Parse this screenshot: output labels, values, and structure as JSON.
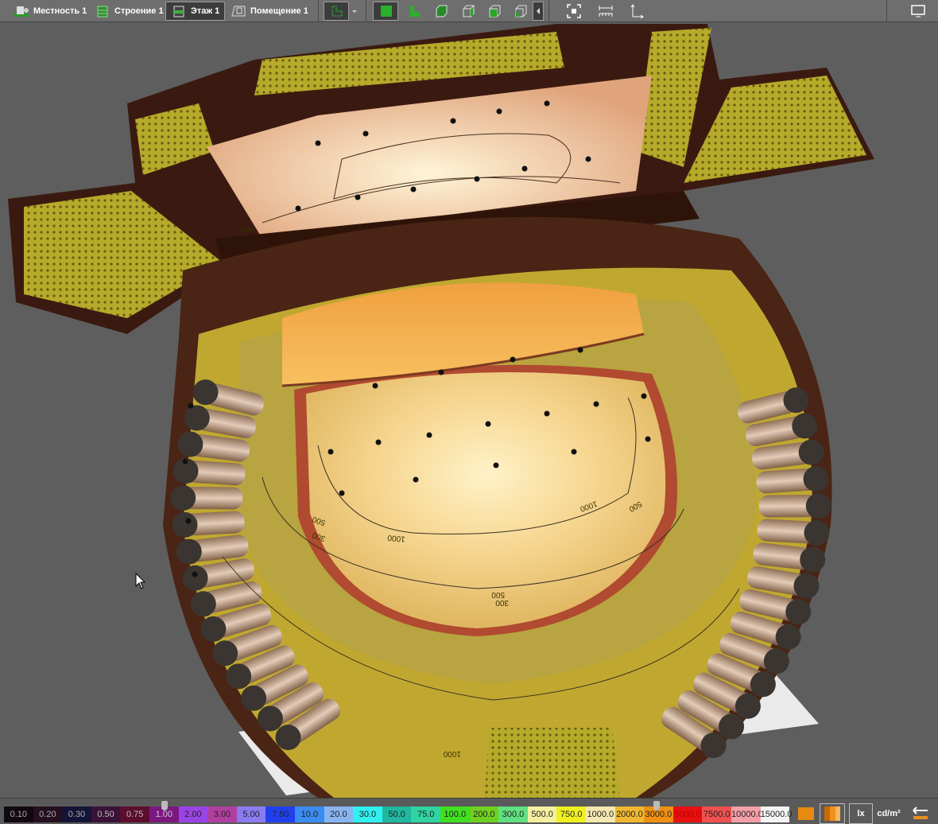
{
  "toolbar": {
    "tabs": [
      {
        "label": "Местность 1",
        "icon": "terrain-icon"
      },
      {
        "label": "Строение 1",
        "icon": "building-icon"
      },
      {
        "label": "Этаж 1",
        "icon": "floor-icon",
        "selected": true
      },
      {
        "label": "Помещение 1",
        "icon": "room-icon"
      }
    ],
    "view_icons": [
      "layout-icon",
      "dropdown-arrow-icon",
      "solid-view-icon",
      "floor-plan-icon",
      "cube-green-icon",
      "cube-wire-icon",
      "cube-side-icon",
      "cube-corner-icon",
      "collapse-arrow-icon",
      "fit-view-icon",
      "measure-icon",
      "axes-icon",
      "monitor-icon"
    ]
  },
  "scene": {
    "contour_labels": [
      "300",
      "500",
      "1000",
      "1000",
      "500",
      "300",
      "300",
      "500",
      "1000"
    ]
  },
  "legend": {
    "cells": [
      {
        "label": "0.10",
        "color": "#120810",
        "text": "#aaa"
      },
      {
        "label": "0.20",
        "color": "#24101e",
        "text": "#aaa"
      },
      {
        "label": "0.30",
        "color": "#141438",
        "text": "#aaa"
      },
      {
        "label": "0.50",
        "color": "#3a1238",
        "text": "#bbb"
      },
      {
        "label": "0.75",
        "color": "#5c0e2e",
        "text": "#bbb"
      },
      {
        "label": "1.00",
        "color": "#7a1880",
        "text": "#ccc"
      },
      {
        "label": "2.00",
        "color": "#9a44e8",
        "text": "#222"
      },
      {
        "label": "3.00",
        "color": "#b040a0",
        "text": "#222"
      },
      {
        "label": "5.00",
        "color": "#8a7cf0",
        "text": "#222"
      },
      {
        "label": "7.50",
        "color": "#2040f0",
        "text": "#222"
      },
      {
        "label": "10.0",
        "color": "#3a8cf0",
        "text": "#222"
      },
      {
        "label": "20.0",
        "color": "#8ab4f0",
        "text": "#222"
      },
      {
        "label": "30.0",
        "color": "#30f0f0",
        "text": "#222"
      },
      {
        "label": "50.0",
        "color": "#20b8a0",
        "text": "#222"
      },
      {
        "label": "75.0",
        "color": "#30d4a0",
        "text": "#222"
      },
      {
        "label": "100.0",
        "color": "#40e020",
        "text": "#222"
      },
      {
        "label": "200.0",
        "color": "#70d020",
        "text": "#222"
      },
      {
        "label": "300.0",
        "color": "#60e080",
        "text": "#222"
      },
      {
        "label": "500.0",
        "color": "#f4f0a0",
        "text": "#222"
      },
      {
        "label": "750.0",
        "color": "#f0f020",
        "text": "#222"
      },
      {
        "label": "1000.0",
        "color": "#f4e8b0",
        "text": "#222"
      },
      {
        "label": "2000.0",
        "color": "#f0b830",
        "text": "#222"
      },
      {
        "label": "3000.0",
        "color": "#f09010",
        "text": "#222"
      },
      {
        "label": "5000.0",
        "color": "#e81010",
        "text": "#b00"
      },
      {
        "label": "7500.0",
        "color": "#f05050",
        "text": "#222"
      },
      {
        "label": "10000.0",
        "color": "#f4a0a8",
        "text": "#222"
      },
      {
        "label": "15000.0",
        "color": "#f4f4f4",
        "text": "#222"
      }
    ],
    "unit_lx": "lx",
    "unit_cd": "cd/m²"
  }
}
